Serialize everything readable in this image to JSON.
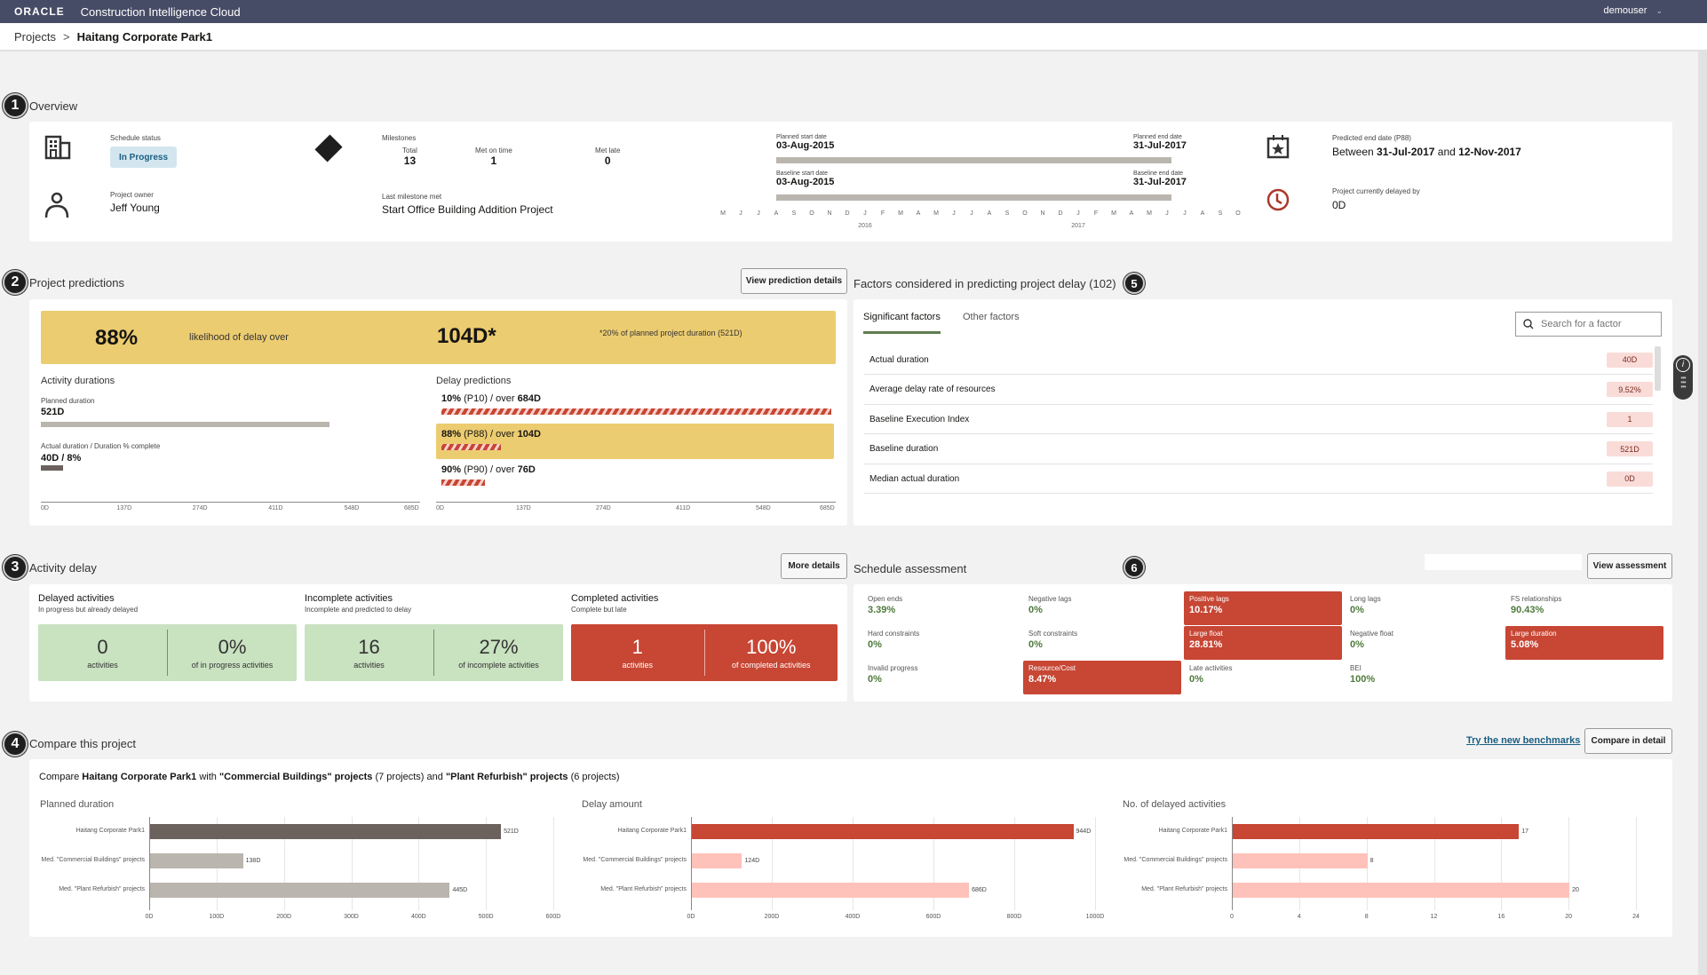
{
  "header": {
    "logo": "ORACLE",
    "app_title": "Construction Intelligence Cloud",
    "user": "demouser"
  },
  "breadcrumb": {
    "root": "Projects",
    "separator": ">",
    "current": "Haitang Corporate Park1"
  },
  "badges": [
    "1",
    "2",
    "3",
    "4",
    "5",
    "6"
  ],
  "overview": {
    "title": "Overview",
    "schedule_status_label": "Schedule status",
    "schedule_status": "In Progress",
    "project_owner_label": "Project owner",
    "project_owner": "Jeff Young",
    "milestones_label": "Milestones",
    "milestones": [
      {
        "label": "Total",
        "value": "13"
      },
      {
        "label": "Met on time",
        "value": "1"
      },
      {
        "label": "Met late",
        "value": "0"
      }
    ],
    "last_milestone_label": "Last milestone met",
    "last_milestone": "Start Office Building Addition Project",
    "planned_start_label": "Planned start date",
    "planned_start": "03-Aug-2015",
    "planned_end_label": "Planned end date",
    "planned_end": "31-Jul-2017",
    "baseline_start_label": "Baseline start date",
    "baseline_start": "03-Aug-2015",
    "baseline_end_label": "Baseline end date",
    "baseline_end": "31-Jul-2017",
    "months": [
      "M",
      "J",
      "J",
      "A",
      "S",
      "O",
      "N",
      "D",
      "J",
      "F",
      "M",
      "A",
      "M",
      "J",
      "J",
      "A",
      "S",
      "O",
      "N",
      "D",
      "J",
      "F",
      "M",
      "A",
      "M",
      "J",
      "J",
      "A",
      "S",
      "O"
    ],
    "years": [
      "2016",
      "2017"
    ],
    "predicted_end_label": "Predicted end date (P88)",
    "predicted_end_prefix": "Between",
    "predicted_end_from": "31-Jul-2017",
    "predicted_end_and": "and",
    "predicted_end_to": "12-Nov-2017",
    "delayed_by_label": "Project currently delayed by",
    "delayed_by": "0D"
  },
  "predictions": {
    "title": "Project predictions",
    "button": "View prediction details",
    "likelihood": "88%",
    "likelihood_text": "likelihood of delay over",
    "delay": "104D*",
    "footnote": "*20% of planned project duration (521D)",
    "activity_durations_title": "Activity durations",
    "planned_duration_label": "Planned duration",
    "planned_duration": "521D",
    "planned_duration_value": 521,
    "actual_label": "Actual duration / Duration % complete",
    "actual": "40D / 8%",
    "actual_value": 40,
    "axis_max": 685,
    "axis_ticks": [
      "0D",
      "137D",
      "274D",
      "411D",
      "548D",
      "685D"
    ],
    "delay_predictions_title": "Delay predictions",
    "delay_rows": [
      {
        "pct": "10%",
        "p": "(P10) / over",
        "days": "684D",
        "value": 684,
        "highlight": false
      },
      {
        "pct": "88%",
        "p": "(P88) / over",
        "days": "104D",
        "value": 104,
        "highlight": true
      },
      {
        "pct": "90%",
        "p": "(P90) / over",
        "days": "76D",
        "value": 76,
        "highlight": false
      }
    ]
  },
  "factors": {
    "title": "Factors considered in predicting project delay (102)",
    "tabs": [
      "Significant factors",
      "Other factors"
    ],
    "search_placeholder": "Search for a factor",
    "rows": [
      {
        "name": "Actual duration",
        "value": "40D"
      },
      {
        "name": "Average delay rate of resources",
        "value": "9.52%"
      },
      {
        "name": "Baseline Execution Index",
        "value": "1"
      },
      {
        "name": "Baseline duration",
        "value": "521D"
      },
      {
        "name": "Median actual duration",
        "value": "0D"
      }
    ]
  },
  "activity_delay": {
    "title": "Activity delay",
    "button": "More details",
    "groups": [
      {
        "title": "Delayed activities",
        "subtitle": "In progress but already delayed",
        "count": "0",
        "count_label": "activities",
        "pct": "0%",
        "pct_label": "of in progress activities",
        "status": "good"
      },
      {
        "title": "Incomplete activities",
        "subtitle": "Incomplete and predicted to delay",
        "count": "16",
        "count_label": "activities",
        "pct": "27%",
        "pct_label": "of incomplete activities",
        "status": "good"
      },
      {
        "title": "Completed activities",
        "subtitle": "Complete but late",
        "count": "1",
        "count_label": "activities",
        "pct": "100%",
        "pct_label": "of completed activities",
        "status": "bad"
      }
    ]
  },
  "schedule_assessment": {
    "title": "Schedule assessment",
    "button": "View assessment",
    "cells": [
      {
        "label": "Open ends",
        "value": "3.39%",
        "bad": false
      },
      {
        "label": "Negative lags",
        "value": "0%",
        "bad": false
      },
      {
        "label": "Positive lags",
        "value": "10.17%",
        "bad": true
      },
      {
        "label": "Long lags",
        "value": "0%",
        "bad": false
      },
      {
        "label": "FS relationships",
        "value": "90.43%",
        "bad": false
      },
      {
        "label": "Hard constraints",
        "value": "0%",
        "bad": false
      },
      {
        "label": "Soft constraints",
        "value": "0%",
        "bad": false
      },
      {
        "label": "Large float",
        "value": "28.81%",
        "bad": true
      },
      {
        "label": "Negative float",
        "value": "0%",
        "bad": false
      },
      {
        "label": "Large duration",
        "value": "5.08%",
        "bad": true
      },
      {
        "label": "Invalid progress",
        "value": "0%",
        "bad": false
      },
      {
        "label": "Resource/Cost",
        "value": "8.47%",
        "bad": true
      },
      {
        "label": "Late activities",
        "value": "0%",
        "bad": false
      },
      {
        "label": "BEI",
        "value": "100%",
        "bad": false
      }
    ]
  },
  "compare": {
    "title": "Compare this project",
    "link": "Try the new benchmarks",
    "button": "Compare in detail",
    "sentence": {
      "t1": "Compare ",
      "b1": "Haitang Corporate Park1",
      "t2": " with ",
      "b2": "\"Commercial Buildings\" projects",
      "t3": " (7 projects) and ",
      "b3": "\"Plant Refurbish\" projects",
      "t4": " (6 projects)"
    }
  },
  "chart_data": [
    {
      "type": "bar",
      "title": "Planned duration",
      "categories": [
        "Haitang Corporate Park1",
        "Med. \"Commercial Buildings\" projects",
        "Med. \"Plant Refurbish\" projects"
      ],
      "values": [
        521,
        138,
        445
      ],
      "value_labels": [
        "521D",
        "138D",
        "445D"
      ],
      "xlim": [
        0,
        600
      ],
      "xticks": [
        "0D",
        "100D",
        "200D",
        "300D",
        "400D",
        "500D",
        "600D"
      ],
      "colors": [
        "#6b625e",
        "#bab5ae",
        "#bab5ae"
      ],
      "orientation": "horizontal",
      "grid": true
    },
    {
      "type": "bar",
      "title": "Delay amount",
      "categories": [
        "Haitang Corporate Park1",
        "Med. \"Commercial Buildings\" projects",
        "Med. \"Plant Refurbish\" projects"
      ],
      "values": [
        944,
        124,
        686
      ],
      "value_labels": [
        "944D",
        "124D",
        "686D"
      ],
      "xlim": [
        0,
        1000
      ],
      "xticks": [
        "0D",
        "200D",
        "400D",
        "600D",
        "800D",
        "1000D"
      ],
      "colors": [
        "#c74634",
        "#ffc2ba",
        "#ffc2ba"
      ],
      "orientation": "horizontal",
      "grid": true
    },
    {
      "type": "bar",
      "title": "No. of delayed activities",
      "categories": [
        "Haitang Corporate Park1",
        "Med. \"Commercial Buildings\" projects",
        "Med. \"Plant Refurbish\" projects"
      ],
      "values": [
        17,
        8,
        20
      ],
      "value_labels": [
        "17",
        "8",
        "20"
      ],
      "xlim": [
        0,
        24
      ],
      "xticks": [
        "0",
        "4",
        "8",
        "12",
        "16",
        "20",
        "24"
      ],
      "colors": [
        "#c74634",
        "#ffc2ba",
        "#ffc2ba"
      ],
      "orientation": "horizontal",
      "grid": true
    }
  ]
}
